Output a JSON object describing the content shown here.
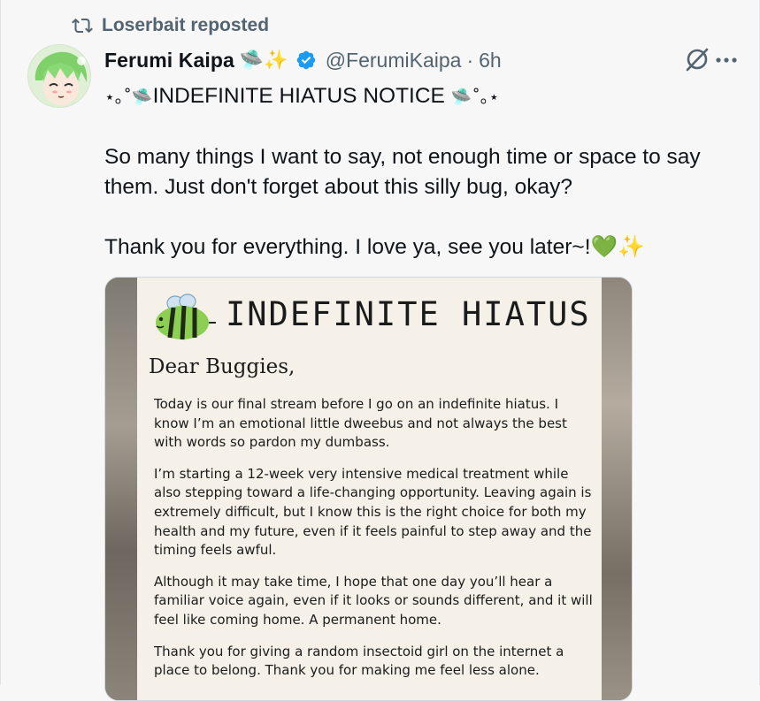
{
  "repost": {
    "label": "Loserbait reposted"
  },
  "author": {
    "name": "Ferumi Kaipa",
    "name_emoji": "🛸✨",
    "handle": "@FerumiKaipa",
    "separator": "·",
    "time": "6h"
  },
  "tweet": {
    "line1_prefix": "⋆｡˚🛸",
    "line1_text": "INDEFINITE HIATUS NOTICE",
    "line1_suffix": "🛸˚｡⋆",
    "para2": "So many things I want to say, not enough time or space to say them. Just don't forget about this silly bug, okay?",
    "para3": "Thank you for everything. I love ya, see you later~!💚✨"
  },
  "image": {
    "title": "INDEFINITE HIATUS",
    "greeting": "Dear Buggies,",
    "paragraphs": [
      "Today is our final stream before I go on an indefinite hiatus. I know I’m an emotional little dweebus and not always the best with words so pardon my dumbass.",
      "I’m starting a 12-week very intensive medical treatment while also stepping toward a life-changing opportunity. Leaving again is extremely difficult, but I know this is the right choice for both my health and my future, even if it feels painful to step away and the timing feels awful.",
      "Although it may take time, I hope that one day you’ll hear a familiar voice again, even if it looks or sounds different, and it will feel like coming home. A permanent home.",
      "Thank you for giving a random insectoid girl on the internet a place to belong. Thank you for making me feel less alone."
    ]
  },
  "colors": {
    "text": "#0f1419",
    "secondary": "#536471",
    "verified": "#1d9bf0",
    "background": "#f7f7f7"
  },
  "icons": [
    "repost-icon",
    "verified-badge-icon",
    "grok-icon",
    "more-icon",
    "bee-icon"
  ]
}
